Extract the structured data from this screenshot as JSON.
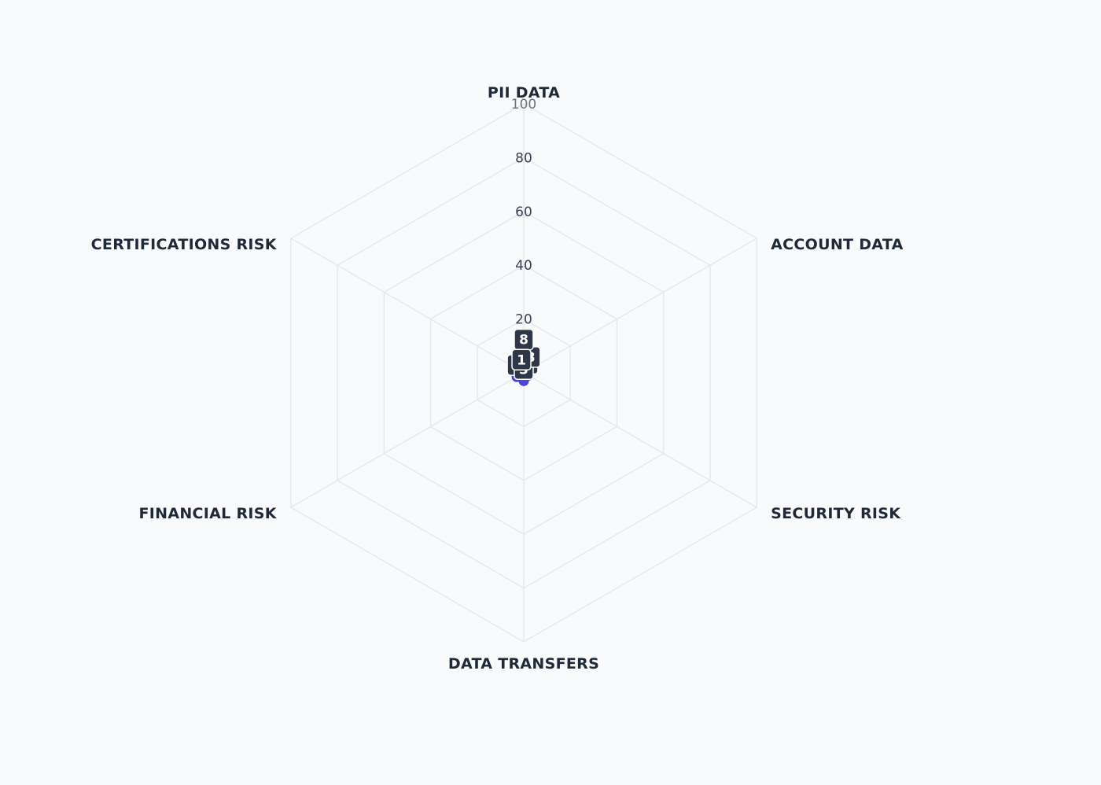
{
  "chart_data": {
    "type": "radar",
    "axes": [
      "PII DATA",
      "ACCOUNT DATA",
      "SECURITY RISK",
      "DATA TRANSFERS",
      "FINANCIAL RISK",
      "CERTIFICATIONS RISK"
    ],
    "rlim": [
      0,
      100
    ],
    "ticks": [
      "20",
      "40",
      "60",
      "80",
      "100"
    ],
    "grid": true,
    "series": [
      {
        "values": [
          8,
          3,
          2,
          3,
          3,
          1
        ]
      }
    ],
    "data_labels": [
      "8",
      "3",
      "2",
      "3",
      "3",
      "1"
    ],
    "colors": {
      "background": "#f9fafc",
      "grid": "#e5e7eb",
      "series": "#4f46e5",
      "badge": "#2d3748"
    }
  }
}
